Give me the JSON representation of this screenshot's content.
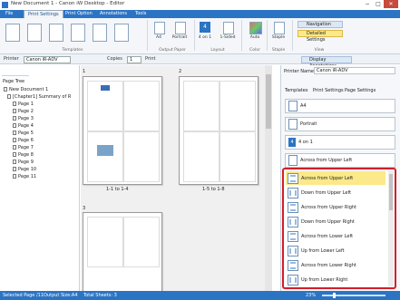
{
  "window": {
    "title": "New Document 1 - Canon iW Desktop - Editor",
    "min": "−",
    "max": "□",
    "close": "✕"
  },
  "ribbon_tabs": [
    "File",
    "Print Settings",
    "Print Option",
    "Annotations",
    "Tools"
  ],
  "ribbon": {
    "groups": {
      "templates": "Templates",
      "output_paper": "Output Paper",
      "layout": "Layout",
      "color": "Color",
      "staple": "Staple",
      "view": "View"
    },
    "buttons": {
      "a4": "A4",
      "portrait": "Portrait",
      "four_on_1": "4 on 1",
      "four_on_1_num": "4",
      "one_sided": "1-Sided",
      "auto": "Auto",
      "staple": "Staple",
      "navigation": "Navigation",
      "detailed_settings": "Detailed Settings"
    }
  },
  "toolbar": {
    "printer_label": "Printer",
    "printer_value": "Canon iR-ADV",
    "copies_label": "Copies",
    "copies_value": "1",
    "print_label": "Print",
    "display_annotations": "Display Annotations"
  },
  "left_pane": {
    "tree_title": "Page Tree",
    "document": "New Document 1",
    "chapter": "[Chapter1] Summary of R",
    "pages": [
      "Page 1",
      "Page 2",
      "Page 3",
      "Page 4",
      "Page 5",
      "Page 6",
      "Page 7",
      "Page 8",
      "Page 9",
      "Page 10",
      "Page 11"
    ]
  },
  "center": {
    "sheet_numbers": [
      "1",
      "2",
      "3"
    ],
    "sheet_captions": [
      "1-1 to 1-4",
      "1-5 to 1-8"
    ]
  },
  "right_pane": {
    "printer_name_label": "Printer Name",
    "printer_name_value": "Canon iR-ADV",
    "tabs": [
      "Templates",
      "Print Settings",
      "Page Settings"
    ],
    "paper": "A4",
    "orientation": "Portrait",
    "layout_num": "4",
    "layout": "4 on 1",
    "order_selected": "Across from Upper Left",
    "order_options": [
      "Across from Upper Left",
      "Down from Upper Left",
      "Across from Upper Right",
      "Down from Upper Right",
      "Across from Lower Left",
      "Up from Lower Left",
      "Across from Lower Right",
      "Up from Lower Right"
    ]
  },
  "status": {
    "selected_page": "Selected Page /11",
    "output_size": "Output Size:A4",
    "total_sheets": "Total Sheets: 3",
    "zoom": "23%"
  },
  "colors": {
    "accent": "#2b74c4",
    "highlight": "#fbe98a",
    "dropdown_outline": "#d0202a"
  }
}
